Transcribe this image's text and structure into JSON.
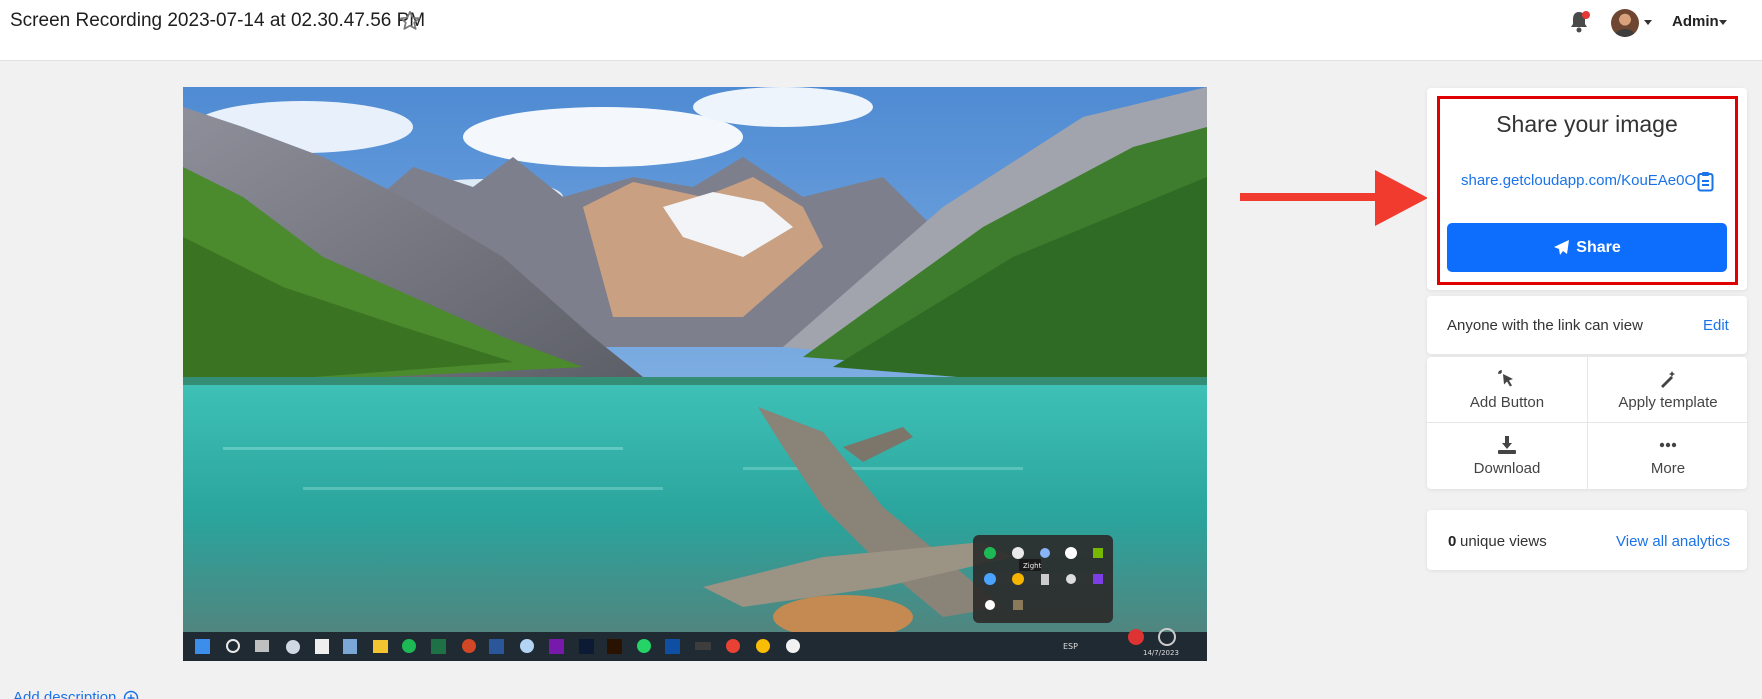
{
  "header": {
    "title": "Screen Recording 2023-07-14 at 02.30.47.56 PM",
    "favorite_icon": "star-icon",
    "notifications_icon": "bell-icon",
    "user_menu": "Admin"
  },
  "media": {
    "taskbar": {
      "language": "ESP",
      "date": "14/7/2023",
      "tooltip": "Zight"
    }
  },
  "share": {
    "heading": "Share your image",
    "link": "share.getcloudapp.com/KouEAe0O",
    "button_label": "Share",
    "permission_text": "Anyone with the link can view",
    "edit_label": "Edit"
  },
  "actions": [
    {
      "label": "Add Button",
      "icon": "cursor-click-icon"
    },
    {
      "label": "Apply template",
      "icon": "magic-wand-icon"
    },
    {
      "label": "Download",
      "icon": "download-icon"
    },
    {
      "label": "More",
      "icon": "more-dots-icon"
    }
  ],
  "analytics": {
    "count": "0",
    "label": "unique views",
    "link": "View all analytics"
  },
  "description": {
    "add_label": "Add description"
  },
  "colors": {
    "accent": "#0d6efd",
    "link": "#1a73e8",
    "highlight": "#e00000",
    "arrow": "#f03b2e"
  }
}
